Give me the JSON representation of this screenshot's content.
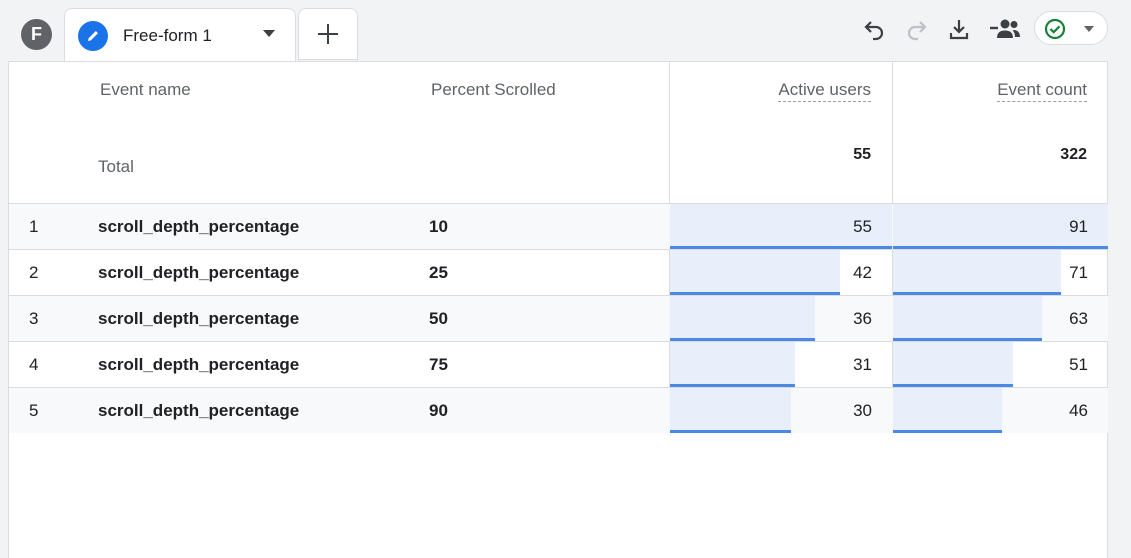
{
  "header": {
    "avatar_letter": "F",
    "tab_label": "Free-form 1"
  },
  "icons": {
    "undo": "undo-icon",
    "redo": "redo-icon",
    "download": "download-icon",
    "share": "share-users-icon",
    "status": "check-circle-icon"
  },
  "colors": {
    "accent": "#1a73e8",
    "bar": "#4a8ae4",
    "bar_fill": "#e8eefa",
    "status_green": "#188038"
  },
  "table": {
    "columns": {
      "event_name": "Event name",
      "percent_scrolled": "Percent Scrolled",
      "active_users": "Active users",
      "event_count": "Event count"
    },
    "total": {
      "label": "Total",
      "active_users": "55",
      "event_count": "322"
    },
    "max": {
      "active_users": 55,
      "event_count": 91
    },
    "rows": [
      {
        "index": "1",
        "event_name": "scroll_depth_percentage",
        "percent": "10",
        "active_users": 55,
        "event_count": 91
      },
      {
        "index": "2",
        "event_name": "scroll_depth_percentage",
        "percent": "25",
        "active_users": 42,
        "event_count": 71
      },
      {
        "index": "3",
        "event_name": "scroll_depth_percentage",
        "percent": "50",
        "active_users": 36,
        "event_count": 63
      },
      {
        "index": "4",
        "event_name": "scroll_depth_percentage",
        "percent": "75",
        "active_users": 31,
        "event_count": 51
      },
      {
        "index": "5",
        "event_name": "scroll_depth_percentage",
        "percent": "90",
        "active_users": 30,
        "event_count": 46
      }
    ]
  }
}
